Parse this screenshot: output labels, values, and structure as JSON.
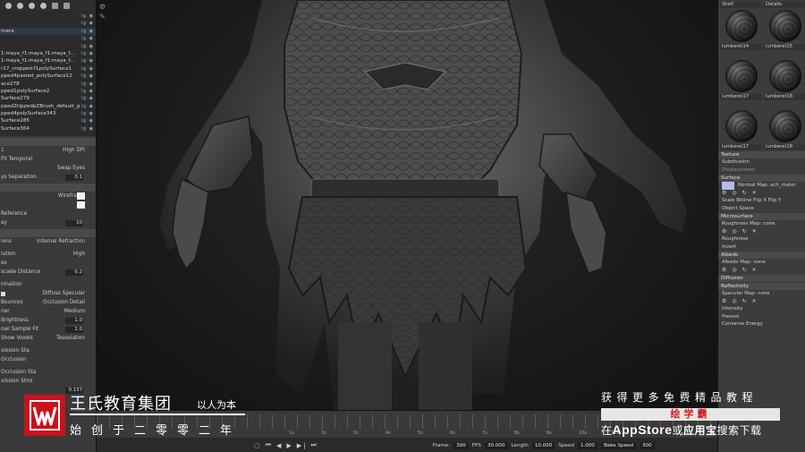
{
  "left_panel": {
    "outliner_rows": [
      "",
      "",
      "mera",
      "",
      "",
      "1:maya_f1:maya_f1:maya_f...",
      "1:maya_f1:maya_f1:maya_f...",
      "r17_cropped:f1polySurface1",
      "pped4pasted_polySurface12",
      "ace278",
      "pped1polySurface2",
      "Surface279",
      "ppedZrippedpZBrush_default_g",
      "pped4polySurface343",
      "Surface285",
      "Surface364"
    ],
    "attributes": [
      {
        "type": "header",
        "label": ""
      },
      {
        "label": "1",
        "value": "High DPI"
      },
      {
        "label": "Fit Temporal",
        "dim": true
      },
      {
        "label": "",
        "value": "Swap Eyes"
      },
      {
        "label": "ys Separation",
        "value": "0.1"
      },
      {
        "type": "header",
        "label": ""
      },
      {
        "label": "",
        "value": "Wireframe",
        "num": "1.0",
        "swatch": true
      },
      {
        "label": "",
        "swatch": true
      },
      {
        "label": "Reference",
        "swatch": false
      },
      {
        "label": "ay",
        "value": "10"
      },
      {
        "type": "header",
        "label": ""
      },
      {
        "label": "ions",
        "value": "Internal Refraction"
      },
      {
        "type": "space"
      },
      {
        "label": "lution",
        "value": "High"
      },
      {
        "label": "es"
      },
      {
        "label": "scade Distance",
        "value": "0.2"
      },
      {
        "type": "space"
      },
      {
        "label": "nination"
      },
      {
        "label": "",
        "value": "Diffuse  Specular",
        "checks": true
      },
      {
        "label": "Bounces",
        "value": "Occlusion Detail"
      },
      {
        "label": "ner",
        "value": "Medium"
      },
      {
        "label": "Brightness",
        "value": "1.0"
      },
      {
        "label": "owl Sample Fit",
        "value": "1.0"
      },
      {
        "label": "Show Voxels",
        "value": "Tesselation"
      },
      {
        "type": "space"
      },
      {
        "label": "xlosion Sta"
      },
      {
        "label": "Occlusion"
      },
      {
        "type": "space"
      },
      {
        "label": "Occlusion Sta"
      },
      {
        "label": "xlosion Stmi"
      },
      {
        "label": "",
        "value": "0.137"
      }
    ]
  },
  "right_panel": {
    "material_tabs": [
      "Shelf",
      "Details"
    ],
    "materials": [
      {
        "label": "lumberet14"
      },
      {
        "label": "lumberet15"
      },
      {
        "label": "lumberet17"
      },
      {
        "label": "lumberet18"
      },
      {
        "label": "lumberet17"
      },
      {
        "label": "lumberet18"
      }
    ],
    "sections": [
      {
        "title": "Texture",
        "rows": [
          "Subdivision",
          "Displacement"
        ]
      },
      {
        "title": "Surface",
        "rows": [
          "Normal Map: ach_mater",
          "Scale Bitline  Flip X  Flip Y",
          "Object Space"
        ]
      },
      {
        "title": "Microsurface",
        "rows": [
          "Roughness Map: none",
          "Roughness",
          "Invert"
        ]
      },
      {
        "title": "Albedo",
        "rows": [
          "Albedo Map: none"
        ]
      },
      {
        "title": "Diffusion",
        "rows": []
      },
      {
        "title": "Reflectivity",
        "rows": [
          "Specular Map: none",
          "Intensity",
          "Fresnel",
          "Conserve Energy"
        ]
      }
    ]
  },
  "timeline": {
    "ruler_numbers": [
      "1s",
      "2s",
      "3s",
      "4s",
      "5s",
      "6s",
      "7s",
      "8s",
      "9s",
      "10s",
      "11s",
      "12s"
    ],
    "frame_label": "Frame:",
    "frame_value": "300",
    "fps_label": "FPS",
    "fps_value": "30.000",
    "length_label": "Length",
    "length_value": "10.000",
    "speed_label": "Speed",
    "speed_value": "1.000",
    "bake_label": "Bake Speed",
    "end_value": "300"
  },
  "overlay": {
    "brand_name": "王氏教育集团",
    "brand_slogan": "以人为本",
    "brand_founded": "始创于二零零二年",
    "promo_top": "获得更多免费精品教程",
    "promo_badge": "绘学霸",
    "promo_bottom_prefix": "在",
    "promo_bottom_store": "AppStore",
    "promo_bottom_mid": "或",
    "promo_bottom_app": "应用宝",
    "promo_bottom_suffix": "搜索下载",
    "brand_color": "#c8131c",
    "badge_text_color": "#d11f1f"
  }
}
